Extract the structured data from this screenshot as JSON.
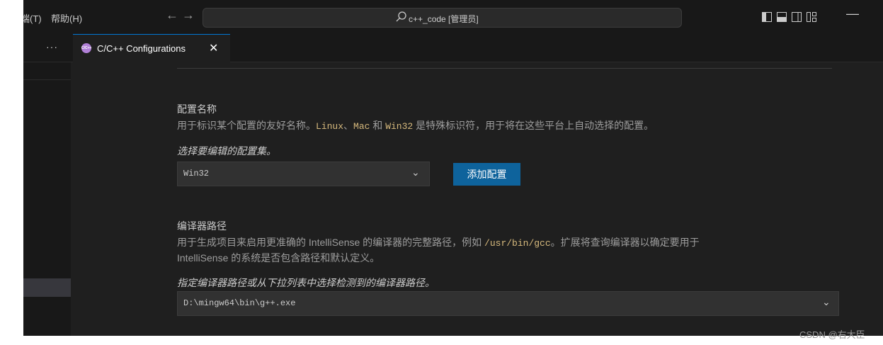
{
  "menu": {
    "terminal_partial": "端(T)",
    "help": "帮助(H)"
  },
  "nav": {
    "back_icon": "←",
    "forward_icon": "→"
  },
  "command_center": {
    "search_icon": "⚲",
    "text": "c++_code [管理员]"
  },
  "window_controls": {
    "minimize": "—"
  },
  "tab_bar": {
    "more_actions": "···"
  },
  "tab": {
    "icon_text": "C/C++",
    "label": "C/C++ Configurations",
    "close": "✕"
  },
  "config_name": {
    "title": "配置名称",
    "desc_before": "用于标识某个配置的友好名称。",
    "code_linux": "Linux",
    "sep1": "、",
    "code_mac": "Mac",
    "and": " 和 ",
    "code_win32": "Win32",
    "desc_after": " 是特殊标识符，用于将在这些平台上自动选择的配置。",
    "hint": "选择要编辑的配置集。",
    "selected": "Win32",
    "chevron": "⌄",
    "add_button": "添加配置"
  },
  "compiler_path": {
    "title": "编译器路径",
    "desc_before": "用于生成项目来启用更准确的 IntelliSense 的编译器的完整路径，例如 ",
    "code_example": "/usr/bin/gcc",
    "desc_after": "。扩展将查询编译器以确定要用于",
    "desc_line2": "IntelliSense 的系统是否包含路径和默认定义。",
    "hint": "指定编译器路径或从下拉列表中选择检测到的编译器路径。",
    "value": "D:\\mingw64\\bin\\g++.exe",
    "chevron": "⌄"
  },
  "watermark": "CSDN @右大臣",
  "colors": {
    "accent": "#0078d4",
    "button": "#0e639c",
    "code": "#d7ba7d",
    "background": "#1f1f1f"
  }
}
